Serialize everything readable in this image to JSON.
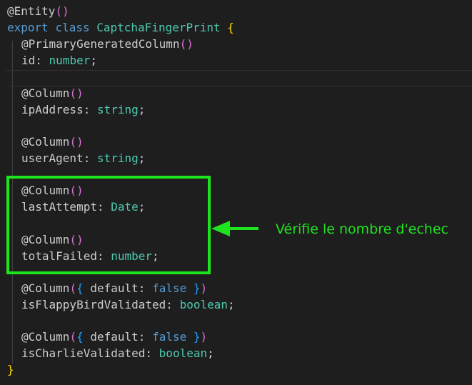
{
  "colors": {
    "background": "#1e1e1e",
    "highlight": "#1de41d",
    "keyword": "#569cd6",
    "type": "#4ec9b0",
    "brace_outer": "#ffd700",
    "paren": "#da70d6",
    "brace_inner": "#179fff",
    "text": "#cccccc"
  },
  "code": {
    "line1": {
      "decorator": "@Entity",
      "paren_open": "(",
      "paren_close": ")"
    },
    "line2": {
      "kw_export": "export",
      "kw_class": "class",
      "class_name": "CaptchaFingerPrint",
      "brace": "{"
    },
    "line3": {
      "decorator": "@PrimaryGeneratedColumn",
      "paren_open": "(",
      "paren_close": ")"
    },
    "line4": {
      "prop": "id",
      "colon": ":",
      "type": "number",
      "semi": ";"
    },
    "line6": {
      "decorator": "@Column",
      "paren_open": "(",
      "paren_close": ")"
    },
    "line7": {
      "prop": "ipAddress",
      "colon": ":",
      "type": "string",
      "semi": ";"
    },
    "line9": {
      "decorator": "@Column",
      "paren_open": "(",
      "paren_close": ")"
    },
    "line10": {
      "prop": "userAgent",
      "colon": ":",
      "type": "string",
      "semi": ";"
    },
    "line12": {
      "decorator": "@Column",
      "paren_open": "(",
      "paren_close": ")"
    },
    "line13": {
      "prop": "lastAttempt",
      "colon": ":",
      "type": "Date",
      "semi": ";"
    },
    "line15": {
      "decorator": "@Column",
      "paren_open": "(",
      "paren_close": ")"
    },
    "line16": {
      "prop": "totalFailed",
      "colon": ":",
      "type": "number",
      "semi": ";"
    },
    "line18": {
      "decorator": "@Column",
      "paren_open": "(",
      "brace_open": "{",
      "key": "default",
      "colon": ":",
      "value": "false",
      "brace_close": "}",
      "paren_close": ")"
    },
    "line19": {
      "prop": "isFlappyBirdValidated",
      "colon": ":",
      "type": "boolean",
      "semi": ";"
    },
    "line21": {
      "decorator": "@Column",
      "paren_open": "(",
      "brace_open": "{",
      "key": "default",
      "colon": ":",
      "value": "false",
      "brace_close": "}",
      "paren_close": ")"
    },
    "line22": {
      "prop": "isCharlieValidated",
      "colon": ":",
      "type": "boolean",
      "semi": ";"
    },
    "line23": {
      "brace": "}"
    }
  },
  "annotation": {
    "text": "Vérifie le nombre d'echec",
    "arrow_icon": "left-arrow-icon"
  }
}
